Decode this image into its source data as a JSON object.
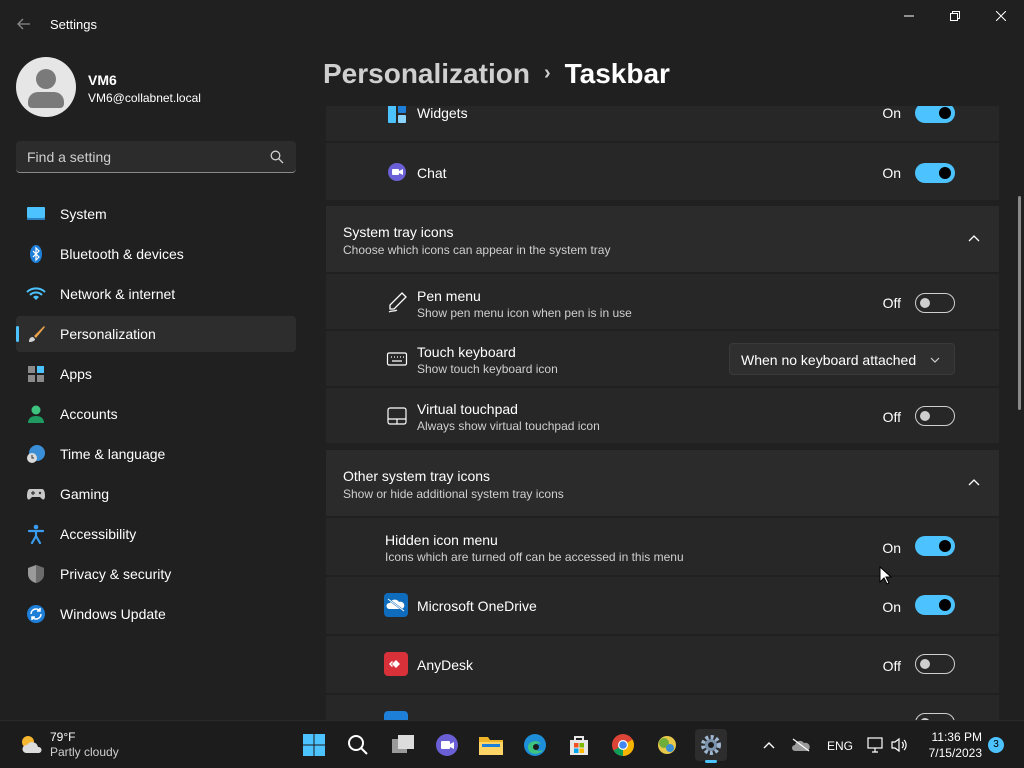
{
  "window": {
    "title": "Settings",
    "back_icon": "back-arrow-icon"
  },
  "profile": {
    "name": "VM6",
    "email": "VM6@collabnet.local"
  },
  "search": {
    "placeholder": "Find a setting"
  },
  "sidebar": {
    "items": [
      {
        "label": "System",
        "icon": "system-icon",
        "active": false
      },
      {
        "label": "Bluetooth & devices",
        "icon": "bluetooth-icon",
        "active": false
      },
      {
        "label": "Network & internet",
        "icon": "wifi-icon",
        "active": false
      },
      {
        "label": "Personalization",
        "icon": "brush-icon",
        "active": true
      },
      {
        "label": "Apps",
        "icon": "apps-icon",
        "active": false
      },
      {
        "label": "Accounts",
        "icon": "person-icon",
        "active": false
      },
      {
        "label": "Time & language",
        "icon": "globe-clock-icon",
        "active": false
      },
      {
        "label": "Gaming",
        "icon": "gamepad-icon",
        "active": false
      },
      {
        "label": "Accessibility",
        "icon": "accessibility-icon",
        "active": false
      },
      {
        "label": "Privacy & security",
        "icon": "shield-icon",
        "active": false
      },
      {
        "label": "Windows Update",
        "icon": "update-icon",
        "active": false
      }
    ]
  },
  "breadcrumb": {
    "parent": "Personalization",
    "separator": "›",
    "current": "Taskbar"
  },
  "taskbar_items": {
    "widgets": {
      "label": "Widgets",
      "state": "On"
    },
    "chat": {
      "label": "Chat",
      "state": "On"
    }
  },
  "system_tray": {
    "title": "System tray icons",
    "description": "Choose which icons can appear in the system tray",
    "pen_menu": {
      "title": "Pen menu",
      "description": "Show pen menu icon when pen is in use",
      "state": "Off"
    },
    "touch_keyboard": {
      "title": "Touch keyboard",
      "description": "Show touch keyboard icon",
      "value": "When no keyboard attached"
    },
    "virtual_touchpad": {
      "title": "Virtual touchpad",
      "description": "Always show virtual touchpad icon",
      "state": "Off"
    }
  },
  "other_tray": {
    "title": "Other system tray icons",
    "description": "Show or hide additional system tray icons",
    "hidden_menu": {
      "title": "Hidden icon menu",
      "description": "Icons which are turned off can be accessed in this menu",
      "state": "On"
    },
    "onedrive": {
      "title": "Microsoft OneDrive",
      "state": "On"
    },
    "anydesk": {
      "title": "AnyDesk",
      "state": "Off"
    }
  },
  "taskbar": {
    "weather": {
      "temp": "79°F",
      "condition": "Partly cloudy"
    },
    "lang": "ENG",
    "time": "11:36 PM",
    "date": "7/15/2023",
    "notifications": "3"
  },
  "colors": {
    "accent": "#4cc2ff",
    "background": "#202020",
    "card": "#2b2b2b"
  }
}
